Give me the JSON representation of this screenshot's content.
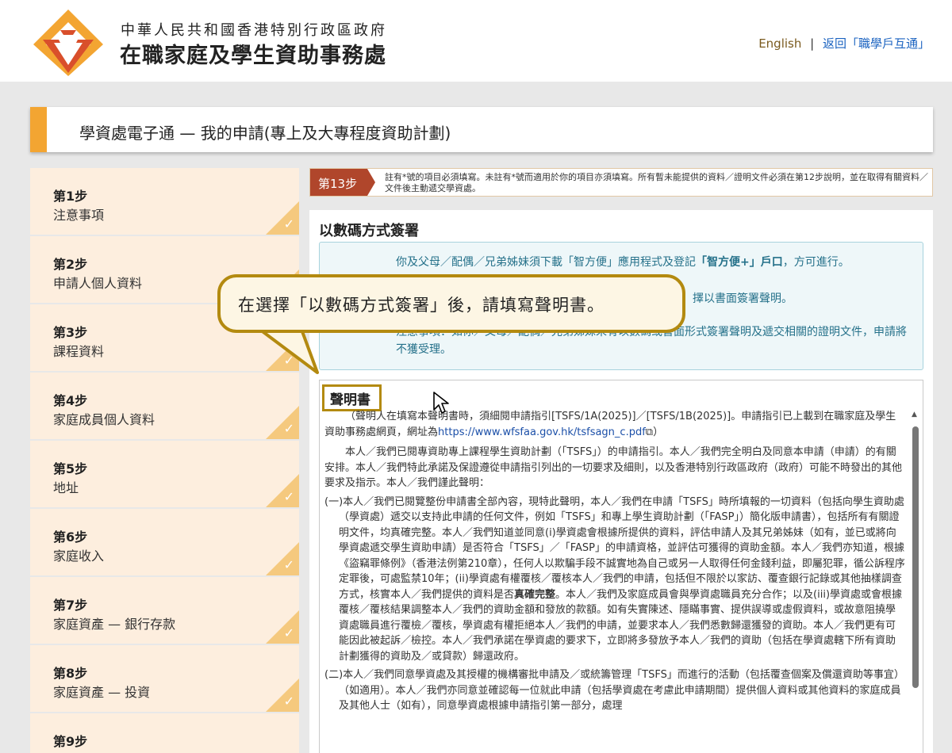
{
  "header": {
    "org_sub": "中華人民共和國香港特別行政區政府",
    "org_main": "在職家庭及學生資助事務處",
    "lang_link": "English",
    "separator": "|",
    "back_link": "返回「職學戶互通」",
    "logo_icon": "wfsfaa-logo-icon"
  },
  "title_bar": {
    "title": "學資處電子通 — 我的申請(專上及大專程度資助計劃)"
  },
  "sidebar": {
    "steps": [
      {
        "num": "第1步",
        "label": "注意事項"
      },
      {
        "num": "第2步",
        "label": "申請人個人資料"
      },
      {
        "num": "第3步",
        "label": "課程資料"
      },
      {
        "num": "第4步",
        "label": "家庭成員個人資料"
      },
      {
        "num": "第5步",
        "label": "地址"
      },
      {
        "num": "第6步",
        "label": "家庭收入"
      },
      {
        "num": "第7步",
        "label": "家庭資產 — 銀行存款"
      },
      {
        "num": "第8步",
        "label": "家庭資產 — 投資"
      },
      {
        "num": "第9步",
        "label": ""
      }
    ],
    "check_glyph": "✓"
  },
  "step_note": {
    "badge": "第13步",
    "text": "註有*號的項目必須填寫。未註有*號而適用於你的項目亦須填寫。所有暫未能提供的資料／證明文件必須在第12步說明，並在取得有關資料／文件後主動遞交學資處。"
  },
  "digital_sign": {
    "title": "以數碼方式簽署",
    "info1_a": "你及父母／配偶／兄弟姊妹須下載「智方便」應用程式及登記",
    "info1_b": "「智方便+」戶口",
    "info1_c": "，方可進行。",
    "info2": "擇以書面簽署聲明。",
    "info3": "注意事項：如你／父母／配偶／兄弟姊妹未有以數碼或書面形式簽署聲明及遞交相關的證明文件，申請將不獲受理。"
  },
  "declaration": {
    "title": "聲明書",
    "p0_a": "（聲明人在填寫本聲明書時，須細閱申請指引[TSFS/1A(2025)]／[TSFS/1B(2025)]。申請指引已上載到在職家庭及學生資助事務處網頁，網址為",
    "p0_link": "https://www.wfsfaa.gov.hk/tsfsagn_c.pdf",
    "p0_b": "）",
    "p1": "本人／我們已閱專資助專上課程學生資助計劃（「TSFS」）的申請指引。本人／我們完全明白及同意本申請（申請）的有關安排。本人／我們特此承諾及保證遵從申請指引列出的一切要求及細則，以及香港特別行政區政府（政府）可能不時發出的其他要求及指示。本人／我們謹此聲明：",
    "item1_a": "(一)本人／我們已閱覽整份申請書全部內容，現特此聲明，本人／我們在申請「TSFS」時所填報的一切資料（包括向學生資助處（學資處）遞交以支持此申請的任何文件，例如「TSFS」和專上學生資助計劃（「FASP」）簡化版申請書），包括所有有關證明文件，均真確完整。本人／我們知道並同意(i)學資處會根據所提供的資料，評估申請人及其兄弟姊妹（如有，並已或將向學資處遞交學生資助申請）是否符合「TSFS」／「FASP」的申請資格，並評估可獲得的資助金額。本人／我們亦知道，根據《盜竊罪條例》（香港法例第210章），任何人以欺騙手段不誠實地為自己或另一人取得任何金錢利益，即屬犯罪，循公訴程序定罪後，可處監禁10年；(ii)學資處有權覆核／覆核本人／我們的申請，包括但不限於以家訪、覆查銀行記錄或其他抽樣調查方式，核實本人／我們提供的資料是否",
    "item1_bold": "真確完整",
    "item1_b": "。本人／我們及家庭成員會與學資處職員充分合作；以及(iii)學資處或會根據覆核／覆核結果調整本人／我們的資助金額和發放的款額。如有失實陳述、隱瞞事實、提供誤導或虛假資料，或故意阻撓學資處職員進行覆檢／覆核，學資處有權拒絕本人／我們的申請，並要求本人／我們悉數歸還獲發的資助。本人／我們更有可能因此被起訴／檢控。本人／我們承諾在學資處的要求下，立即將多發放予本人／我們的資助（包括在學資處轄下所有資助計劃獲得的資助及／或貸款）歸還政府。",
    "item2": "(二)本人／我們同意學資處及其授權的機構審批申請及／或統籌管理「TSFS」而進行的活動（包括覆查個案及償還資助等事宜）（如適用）。本人／我們亦同意並確認每一位就此申請（包括學資處在考慮此申請期間）提供個人資料或其他資料的家庭成員及其他人士（如有），同意學資處根據申請指引第一部分，處理"
  },
  "callout": {
    "text": "在選擇「以數碼方式簽署」後，請填寫聲明書。"
  },
  "colors": {
    "accent_orange": "#f3a532",
    "step_badge": "#b0462b",
    "callout_border": "#b38a10",
    "info_text": "#25718a",
    "link_blue": "#1b63c0"
  }
}
